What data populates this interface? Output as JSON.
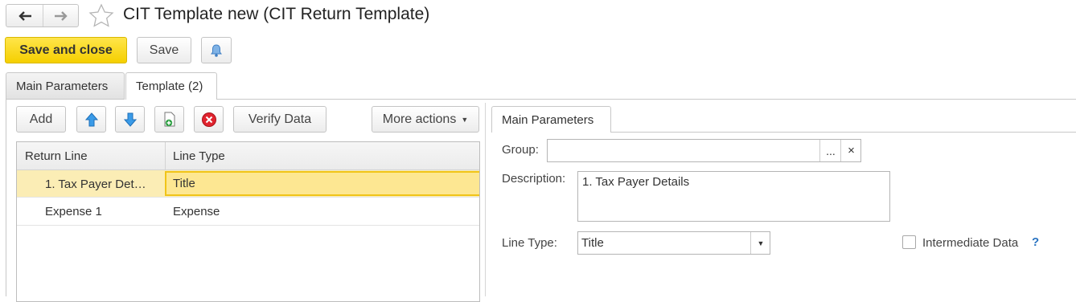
{
  "window": {
    "title": "CIT Template new (CIT Return Template)"
  },
  "nav": {
    "back_icon": "arrow-left-icon",
    "forward_icon": "arrow-right-icon",
    "favorite_icon": "star-icon"
  },
  "toolbar": {
    "save_and_close": "Save and close",
    "save": "Save",
    "notify_icon": "bell-icon"
  },
  "tabs": [
    {
      "label": "Main Parameters",
      "active": false
    },
    {
      "label": "Template (2)",
      "active": true
    }
  ],
  "list_toolbar": {
    "add": "Add",
    "move_up_icon": "arrow-up-icon",
    "move_down_icon": "arrow-down-icon",
    "copy_icon": "add-document-icon",
    "delete_icon": "delete-icon",
    "verify": "Verify Data",
    "more": "More actions"
  },
  "table": {
    "columns": [
      "Return Line",
      "Line Type"
    ],
    "rows": [
      {
        "return_line": "1. Tax Payer Det…",
        "line_type": "Title",
        "selected": true
      },
      {
        "return_line": "Expense 1",
        "line_type": "Expense",
        "selected": false
      }
    ]
  },
  "detail": {
    "tab": "Main Parameters",
    "group_label": "Group:",
    "group_value": "",
    "group_select": "...",
    "group_clear": "×",
    "description_label": "Description:",
    "description_value": "1. Tax Payer Details",
    "line_type_label": "Line Type:",
    "line_type_value": "Title",
    "intermediate_label": "Intermediate Data",
    "intermediate_checked": false,
    "help": "?"
  },
  "colors": {
    "accent_yellow": "#f5cf00",
    "selected_row": "#fbedb5",
    "selected_cell": "#fde792",
    "help_blue": "#2a74c2"
  }
}
